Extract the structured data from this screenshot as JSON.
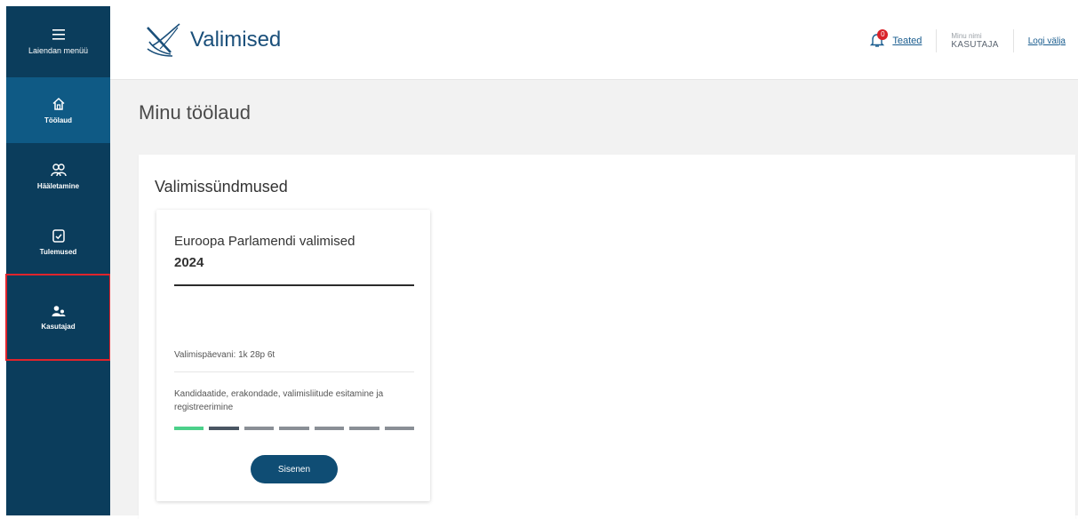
{
  "sidebar": {
    "menu_label": "Laiendan menüü",
    "items": [
      {
        "label": "Töölaud",
        "icon": "home-icon"
      },
      {
        "label": "Hääletamine",
        "icon": "voting-icon"
      },
      {
        "label": "Tulemused",
        "icon": "results-icon"
      },
      {
        "label": "Kasutajad",
        "icon": "users-icon"
      }
    ]
  },
  "header": {
    "logo_text": "Valimised",
    "notifications_label": "Teated",
    "notifications_count": "0",
    "user_caption": "Minu nimi",
    "user_name": "KASUTAJA",
    "logout_label": "Logi välja"
  },
  "main": {
    "page_title": "Minu töölaud",
    "panel_title": "Valimissündmused",
    "card": {
      "title": "Euroopa Parlamendi valimised",
      "year": "2024",
      "days_until": "Valimispäevani: 1k 28p 6t",
      "phase": "Kandidaatide, erakondade, valimisliitude esitamine ja registreerimine",
      "progress": {
        "total": 7,
        "completed": 1,
        "current": 2
      },
      "enter_label": "Sisenen"
    }
  },
  "colors": {
    "sidebar_bg": "#0b3d5c",
    "sidebar_active": "#0f5a85",
    "highlight": "#e0242c",
    "progress_done": "#4cd08a",
    "button_bg": "#0f4d74"
  }
}
